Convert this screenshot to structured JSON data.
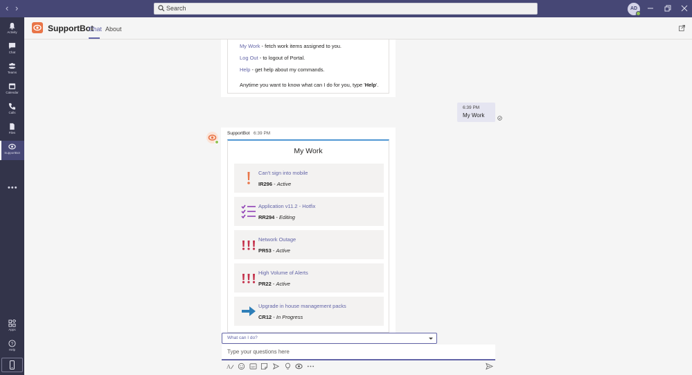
{
  "search": {
    "placeholder": "Search"
  },
  "user": {
    "initials": "AD"
  },
  "rail": {
    "items": [
      {
        "label": "Activity"
      },
      {
        "label": "Chat"
      },
      {
        "label": "Teams"
      },
      {
        "label": "Calendar"
      },
      {
        "label": "Calls"
      },
      {
        "label": "Files"
      },
      {
        "label": "SupportBot"
      }
    ],
    "more": "•••",
    "bottom": [
      {
        "label": "Apps"
      },
      {
        "label": "Help"
      }
    ]
  },
  "header": {
    "title": "SupportBot",
    "tabs": [
      {
        "label": "Chat"
      },
      {
        "label": "About"
      }
    ]
  },
  "help_card": {
    "lines": [
      {
        "cmd": "My Work",
        "desc": " - fetch work items assigned to you."
      },
      {
        "cmd": "Log Out",
        "desc": " - to logout of Portal."
      },
      {
        "cmd": "Help",
        "desc": " - get help about my commands."
      }
    ],
    "footer_prefix": "Anytime you want to know what can I do for you, type '",
    "footer_keyword": "Help",
    "footer_suffix": "'."
  },
  "sent_message": {
    "time": "6:39 PM",
    "text": "My Work"
  },
  "bot_message": {
    "sender": "SupportBot",
    "time": "6:39 PM",
    "card_title": "My Work",
    "items": [
      {
        "icon": "exclamation-icon",
        "title": "Can't sign into mobile",
        "id": "IR296",
        "status": "Active"
      },
      {
        "icon": "checklist-icon",
        "title": "Application v11.2 - Hotfix",
        "id": "RR294",
        "status": "Editing"
      },
      {
        "icon": "triple-exclamation-icon",
        "title": "Network Outage",
        "id": "PR53",
        "status": "Active"
      },
      {
        "icon": "triple-exclamation-icon",
        "title": "High Volume of Alerts",
        "id": "PR22",
        "status": "Active"
      },
      {
        "icon": "arrow-right-icon",
        "title": "Upgrade in house management packs",
        "id": "CR12",
        "status": "In Progress"
      }
    ]
  },
  "suggestion": {
    "text": "What can I do?"
  },
  "compose": {
    "placeholder": "Type your questions here"
  },
  "colors": {
    "titlebar": "#464775",
    "rail": "#33344a",
    "accent": "#6264a7",
    "bot_brand": "#e97548",
    "card_accent": "#4f97d3",
    "warning": "#e97548",
    "critical": "#c4314b",
    "checklist": "#8f3fb5",
    "arrow": "#2f7fb8"
  }
}
